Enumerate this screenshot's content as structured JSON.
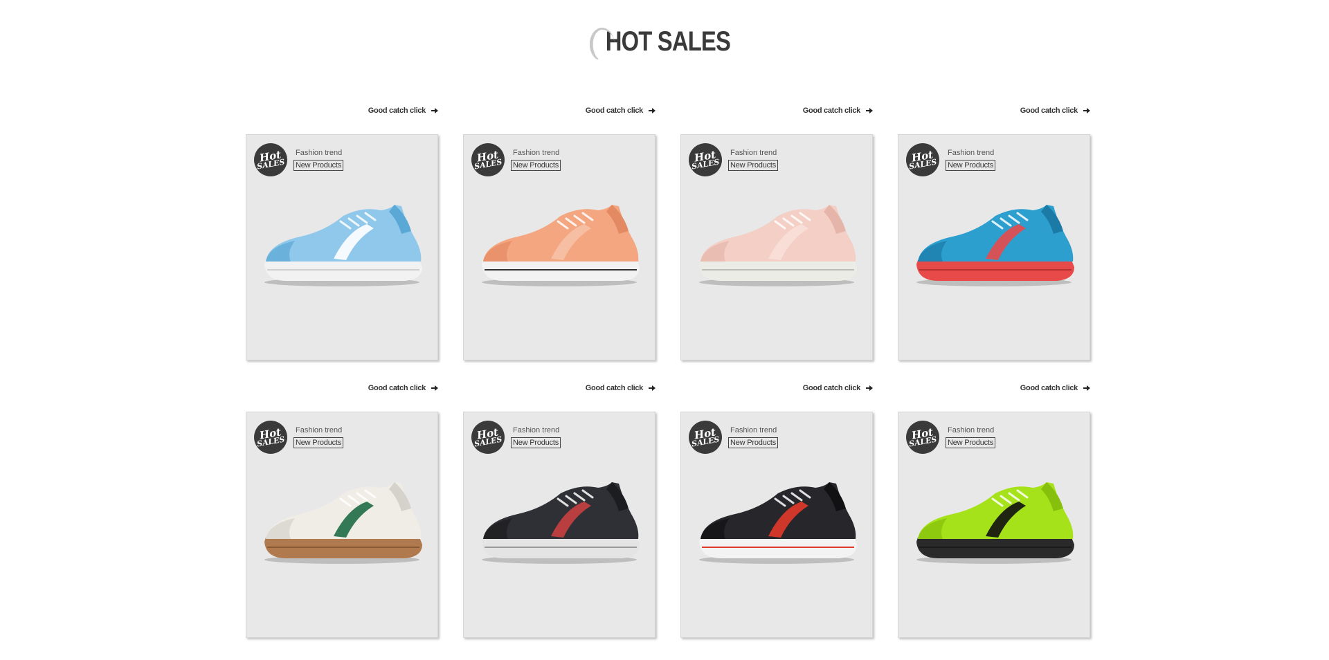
{
  "page": {
    "title": "HOT SALES"
  },
  "products": [
    {
      "link_label": "Good catch click",
      "badge_top": "Hot",
      "badge_bottom": "SALES",
      "tag": "Fashion trend",
      "label": "New Products",
      "shoe": {
        "upper": "#8fc8ea",
        "upper_dark": "#5aa8d6",
        "sole": "#f2f2f2",
        "sole_line": "#cfcfcf",
        "accent": "#ffffff"
      }
    },
    {
      "link_label": "Good catch click",
      "badge_top": "Hot",
      "badge_bottom": "SALES",
      "tag": "Fashion trend",
      "label": "New Products",
      "shoe": {
        "upper": "#f4a680",
        "upper_dark": "#e48a62",
        "sole": "#f2f2f2",
        "sole_line": "#333333",
        "accent": "#f6c2a6"
      }
    },
    {
      "link_label": "Good catch click",
      "badge_top": "Hot",
      "badge_bottom": "SALES",
      "tag": "Fashion trend",
      "label": "New Products",
      "shoe": {
        "upper": "#f3cfc6",
        "upper_dark": "#e6b5aa",
        "sole": "#ecece6",
        "sole_line": "#bdbdb5",
        "accent": "#f8dfd8"
      }
    },
    {
      "link_label": "Good catch click",
      "badge_top": "Hot",
      "badge_bottom": "SALES",
      "tag": "Fashion trend",
      "label": "New Products",
      "shoe": {
        "upper": "#2c9fcf",
        "upper_dark": "#1b7aa6",
        "sole": "#e84a4a",
        "sole_line": "#b52f2f",
        "accent": "#e84a4a"
      }
    },
    {
      "link_label": "Good catch click",
      "badge_top": "Hot",
      "badge_bottom": "SALES",
      "tag": "Fashion trend",
      "label": "New Products",
      "shoe": {
        "upper": "#efede6",
        "upper_dark": "#d4d2cb",
        "sole": "#b07a4e",
        "sole_line": "#8a5a35",
        "accent": "#1f6b45"
      }
    },
    {
      "link_label": "Good catch click",
      "badge_top": "Hot",
      "badge_bottom": "SALES",
      "tag": "Fashion trend",
      "label": "New Products",
      "shoe": {
        "upper": "#2f3035",
        "upper_dark": "#1c1d20",
        "sole": "#e4e4e4",
        "sole_line": "#9a9a9a",
        "accent": "#c94040"
      }
    },
    {
      "link_label": "Good catch click",
      "badge_top": "Hot",
      "badge_bottom": "SALES",
      "tag": "Fashion trend",
      "label": "New Products",
      "shoe": {
        "upper": "#26262b",
        "upper_dark": "#111114",
        "sole": "#f3f3f3",
        "sole_line": "#e23a2a",
        "accent": "#e23a2a"
      }
    },
    {
      "link_label": "Good catch click",
      "badge_top": "Hot",
      "badge_bottom": "SALES",
      "tag": "Fashion trend",
      "label": "New Products",
      "shoe": {
        "upper": "#a6e21a",
        "upper_dark": "#86bf0c",
        "sole": "#2a2a2a",
        "sole_line": "#1a1a1a",
        "accent": "#111111"
      }
    }
  ]
}
